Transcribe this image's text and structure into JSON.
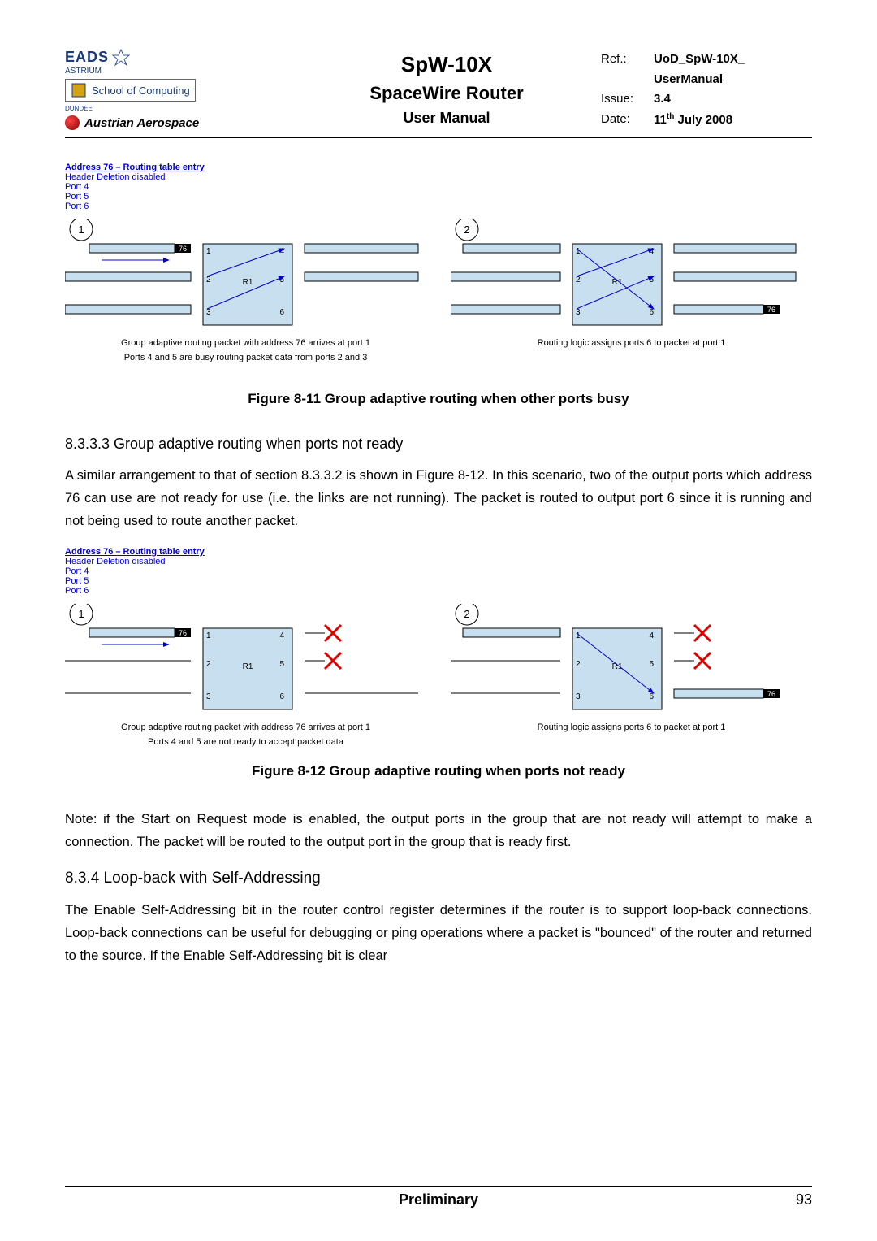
{
  "header": {
    "eads": "EADS",
    "eads_sub": "ASTRIUM",
    "soc": "School of Computing",
    "dundee": "DUNDEE",
    "austrian": "Austrian Aerospace",
    "title": "SpW-10X",
    "subtitle": "SpaceWire Router",
    "subtitle2": "User Manual",
    "ref_label": "Ref.:",
    "ref_val": "UoD_SpW-10X_",
    "ref_val2": "UserManual",
    "issue_label": "Issue:",
    "issue_val": "3.4",
    "date_label": "Date:",
    "date_val": "11",
    "date_sup": "th",
    "date_rest": " July 2008"
  },
  "addr_block": {
    "title": "Address 76 – Routing table entry",
    "lines": [
      "Header Deletion disabled",
      "Port 4",
      "Port 5",
      "Port 6"
    ]
  },
  "fig1": {
    "step1": "1",
    "step2": "2",
    "addr": "76",
    "r1": "R1",
    "cap1a": "Group adaptive routing packet with address 76 arrives at port 1",
    "cap1b": "Ports 4 and 5 are busy routing packet data from ports 2 and 3",
    "cap2": "Routing logic assigns ports 6 to packet at port 1",
    "title": "Figure 8-11 Group adaptive routing when other ports busy"
  },
  "sec8333": {
    "heading": "8.3.3.3  Group adaptive routing when ports not ready",
    "para": "A similar arrangement to that of section 8.3.3.2 is shown in Figure 8-12. In this scenario, two of the output ports which address 76 can use are not ready for use (i.e. the links are not running).  The packet is routed to output port 6 since it is running and not being used to route another packet."
  },
  "fig2": {
    "cap1a": "Group adaptive routing packet with address 76 arrives at port 1",
    "cap1b": "Ports 4 and 5 are not ready to accept packet data",
    "cap2": "Routing logic assigns ports 6 to packet at port 1",
    "title": "Figure 8-12 Group adaptive routing when ports not ready"
  },
  "note": "Note: if the Start on Request mode is enabled, the output ports in the group that are not ready will attempt to make a connection.  The packet will be routed to the output port in the group that is ready first.",
  "sec834": {
    "heading": "8.3.4  Loop-back with Self-Addressing",
    "para": "The Enable Self-Addressing bit in the router control register determines if the router is to support loop-back connections.  Loop-back connections can be useful for debugging or ping operations where a packet is \"bounced\" of the router and returned to the source.  If the Enable Self-Addressing bit is clear"
  },
  "footer": {
    "center": "Preliminary",
    "page": "93"
  }
}
